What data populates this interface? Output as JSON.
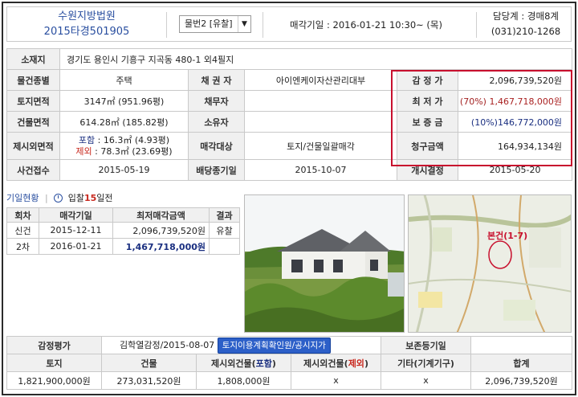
{
  "header": {
    "court": "수원지방법원",
    "case_no": "2015타경501905",
    "item_select": "물번2 [유찰]",
    "auction_date_label": "매각기일 : 2016-01-21  10:30~ (목)",
    "dept": "담당계 : 경매8계",
    "phone": "(031)210-1268"
  },
  "info": {
    "address_label": "소재지",
    "address": "경기도 용인시 기흥구 지곡동 480-1 외4필지",
    "type_label": "물건종별",
    "type": "주택",
    "creditor_label": "채 권 자",
    "creditor": "아이엔케이자산관리대부",
    "appraisal_label": "감 정 가",
    "appraisal": "2,096,739,520원",
    "land_label": "토지면적",
    "land": "3147㎡ (951.96평)",
    "debtor_label": "채무자",
    "debtor": "",
    "min_label": "최 저 가",
    "min_pct": "(70%)",
    "min": "1,467,718,000원",
    "bldg_label": "건물면적",
    "bldg": "614.28㎡ (185.82평)",
    "owner_label": "소유자",
    "owner": "",
    "deposit_label": "보 증 금",
    "deposit_pct": "(10%)",
    "deposit": "146,772,000원",
    "extra_label": "제시외면적",
    "extra_incl_label": "포함",
    "extra_incl": " : 16.3㎡ (4.93평)",
    "extra_excl_label": "제외",
    "extra_excl": " : 78.3㎡ (23.69평)",
    "sale_target_label": "매각대상",
    "sale_target": "토지/건물일괄매각",
    "claim_label": "청구금액",
    "claim": "164,934,134원",
    "received_label": "사건접수",
    "received": "2015-05-19",
    "dividend_label": "배당종기일",
    "dividend": "2015-10-07",
    "commence_label": "개시결정",
    "commence": "2015-05-20"
  },
  "history": {
    "tab_status": "기일현황",
    "tab_sep": "|",
    "ticket_text": "입찰",
    "ticket_days": "15",
    "ticket_suffix": "일전",
    "col_round": "회차",
    "col_date": "매각기일",
    "col_min": "최저매각금액",
    "col_result": "결과",
    "rows": [
      {
        "round": "신건",
        "date": "2015-12-11",
        "min": "2,096,739,520원",
        "result": "유찰"
      },
      {
        "round": "2차",
        "date": "2016-01-21",
        "min": "1,467,718,000원",
        "result": ""
      }
    ]
  },
  "map": {
    "label": "본건(1-7)"
  },
  "appraisal": {
    "label": "감정평가",
    "org": "김학열감정/2015-08-07",
    "btn": "토지이용계획확인원/공시지가",
    "reg_label": "보존등기일",
    "reg_value": "",
    "col_land": "토지",
    "col_bldg": "건물",
    "col_extra_incl_a": "제시외건물(",
    "col_extra_incl_b": "포함",
    "col_extra_incl_c": ")",
    "col_extra_excl_a": "제시외건물(",
    "col_extra_excl_b": "제외",
    "col_extra_excl_c": ")",
    "col_other": "기타(기계기구)",
    "col_total": "합계",
    "land": "1,821,900,000원",
    "bldg": "273,031,520원",
    "extra_incl": "1,808,000원",
    "extra_excl": "x",
    "other": "x",
    "total": "2,096,739,520원"
  },
  "colors": {
    "accent_blue": "#2a4fa0",
    "highlight_red": "#c8102e",
    "button_blue": "#2c5fc8"
  },
  "icons": {
    "select_arrow": "chevron-down-icon",
    "ticket": "clock-icon"
  }
}
